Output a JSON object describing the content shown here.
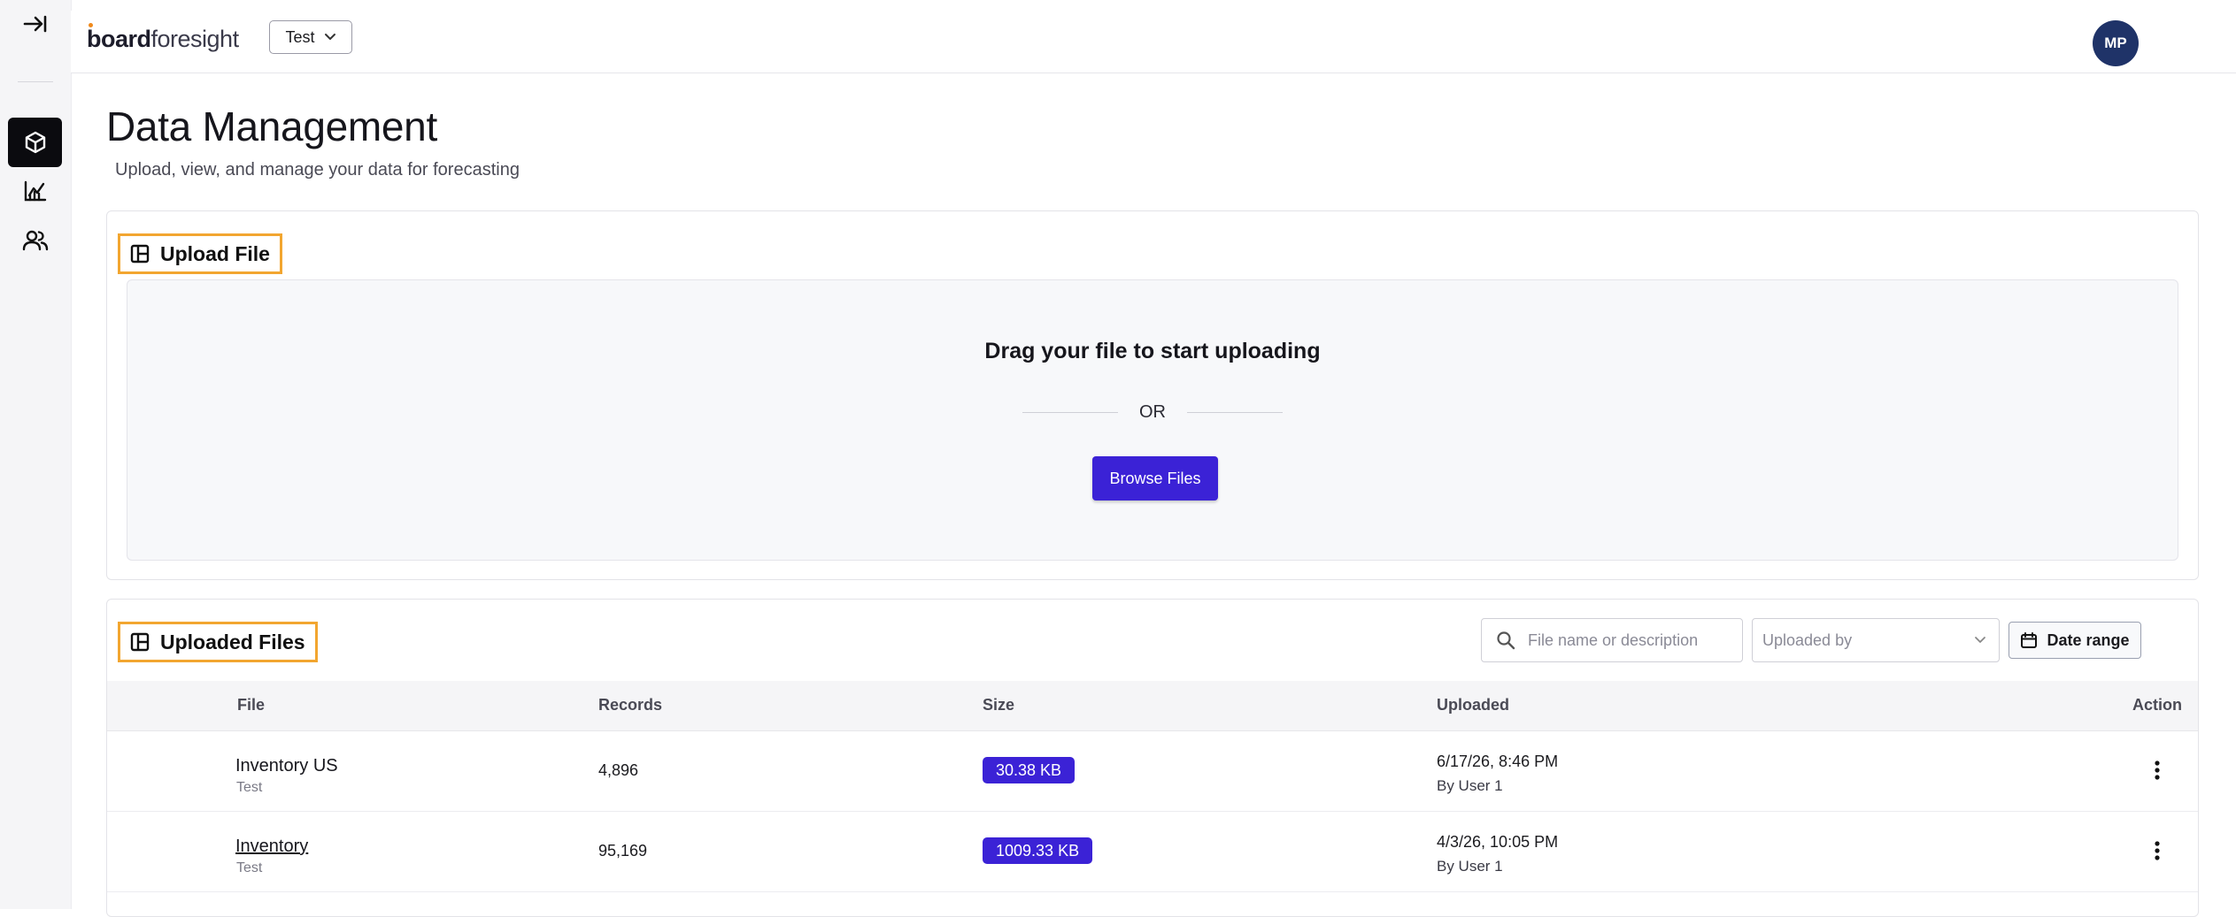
{
  "app": {
    "logo_bold": "board",
    "logo_light": "foresight",
    "workspace": "Test",
    "avatar_initials": "MP"
  },
  "nav": {
    "collapse_icon": "collapse-right-icon",
    "items": [
      {
        "icon": "cube-icon",
        "active": true
      },
      {
        "icon": "chart-icon",
        "active": false
      },
      {
        "icon": "users-icon",
        "active": false
      }
    ]
  },
  "page": {
    "title": "Data Management",
    "subtitle": "Upload, view, and manage your data for forecasting"
  },
  "upload": {
    "title": "Upload File",
    "drop_text": "Drag your file to start uploading",
    "or_text": "OR",
    "browse_label": "Browse Files"
  },
  "files": {
    "title": "Uploaded Files",
    "search_placeholder": "File name or description",
    "uploaded_by_placeholder": "Uploaded by",
    "date_range_label": "Date range",
    "columns": {
      "file": "File",
      "records": "Records",
      "size": "Size",
      "uploaded": "Uploaded",
      "action": "Action"
    },
    "rows": [
      {
        "name": "Inventory US",
        "workspace": "Test",
        "records": "4,896",
        "size": "30.38 KB",
        "date": "6/17/26, 8:46 PM",
        "by": "By User 1"
      },
      {
        "name": "Inventory",
        "workspace": "Test",
        "records": "95,169",
        "size": "1009.33 KB",
        "date": "4/3/26, 10:05 PM",
        "by": "By User 1"
      }
    ]
  },
  "colors": {
    "accent": "#3b22d6",
    "highlight": "#f2a630",
    "avatar": "#1f3368"
  }
}
